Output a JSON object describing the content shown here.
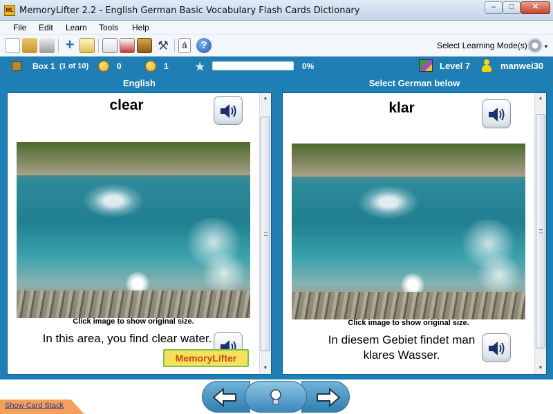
{
  "window": {
    "title": "MemoryLifter 2.2 - English German Basic Vocabulary Flash Cards Dictionary",
    "app_icon_text": "ML",
    "controls": {
      "minimize": "–",
      "maximize": "□",
      "close": "✕"
    }
  },
  "menu": {
    "items": [
      "File",
      "Edit",
      "Learn",
      "Tools",
      "Help"
    ]
  },
  "toolbar": {
    "icons": [
      "new-icon",
      "open-icon",
      "print-icon",
      "add-card-icon",
      "edit-icon",
      "slideshow-icon",
      "statistics-icon",
      "box-icon",
      "settings-icon",
      "special-chars-icon",
      "help-icon"
    ],
    "special_chars_glyph": "á",
    "help_glyph": "?",
    "select_mode_label": "Select Learning Mode(s)"
  },
  "status": {
    "box_label": "Box 1",
    "box_range": "(1 of 10)",
    "wrong_count": "0",
    "right_count": "1",
    "progress_percent": 0,
    "progress_label": "0%",
    "level_label": "Level 7",
    "username": "manwei30"
  },
  "question": {
    "column_title": "English",
    "word": "clear",
    "caption": "Click image to show original size.",
    "sentence": "In this area, you find clear water."
  },
  "answer": {
    "column_title": "Select German below",
    "word": "klar",
    "caption": "Click image to show original size.",
    "sentence": "In diesem Gebiet findet man klares Wasser."
  },
  "watermark": "MemoryLifter",
  "bottom": {
    "show_card_stack": "Show Card Stack"
  },
  "colors": {
    "accent": "#1d7fb5",
    "status_bar": "#1f7fb4",
    "progress": "#7fd27f",
    "tab_orange": "#f4a05a"
  }
}
